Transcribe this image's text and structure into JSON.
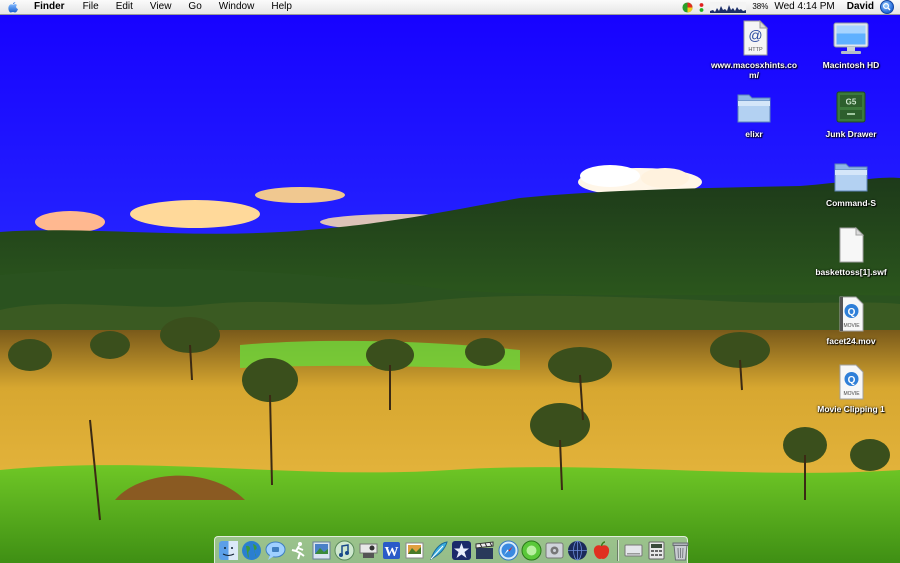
{
  "menubar": {
    "app_name": "Finder",
    "menus": [
      "File",
      "Edit",
      "View",
      "Go",
      "Window",
      "Help"
    ],
    "battery_percent": "38%",
    "clock": "Wed 4:14 PM",
    "user": "David"
  },
  "desktop_icons": [
    {
      "label": "www.macosxhints.co m/",
      "badge": "HTTP",
      "icon": "webloc-icon"
    },
    {
      "label": "Macintosh HD",
      "icon": "hard-drive-icon"
    },
    {
      "label": "elixr",
      "icon": "folder-icon"
    },
    {
      "label": "Junk Drawer",
      "badge": "G5",
      "icon": "junk-drawer-icon"
    },
    {
      "label": "Command-S",
      "icon": "folder-icon"
    },
    {
      "label": "baskettoss[1].swf",
      "icon": "document-icon"
    },
    {
      "label": "facet24.mov",
      "badge": "MOVIE",
      "icon": "movie-file-icon"
    },
    {
      "label": "Movie Clipping 1",
      "badge": "MOVIE",
      "icon": "movie-clipping-icon"
    }
  ],
  "dock": {
    "apps": [
      "finder-icon",
      "globe-icon",
      "ichat-icon",
      "running-man-icon",
      "preview-icon",
      "itunes-icon",
      "projector-icon",
      "word-icon",
      "iphoto-icon",
      "feather-icon",
      "imovie-star-icon",
      "clapper-icon",
      "safari-icon",
      "green-app-icon",
      "system-preferences-icon",
      "dark-globe-icon",
      "apple-red-icon"
    ],
    "documents": [
      "disk-icon",
      "calculator-icon",
      "trash-icon"
    ]
  },
  "colors": {
    "sky_top": "#1a00ff",
    "sky_bottom": "#3b46ff",
    "hills": "#214a1a",
    "field": "#d8a628",
    "grass": "#63c21f"
  }
}
